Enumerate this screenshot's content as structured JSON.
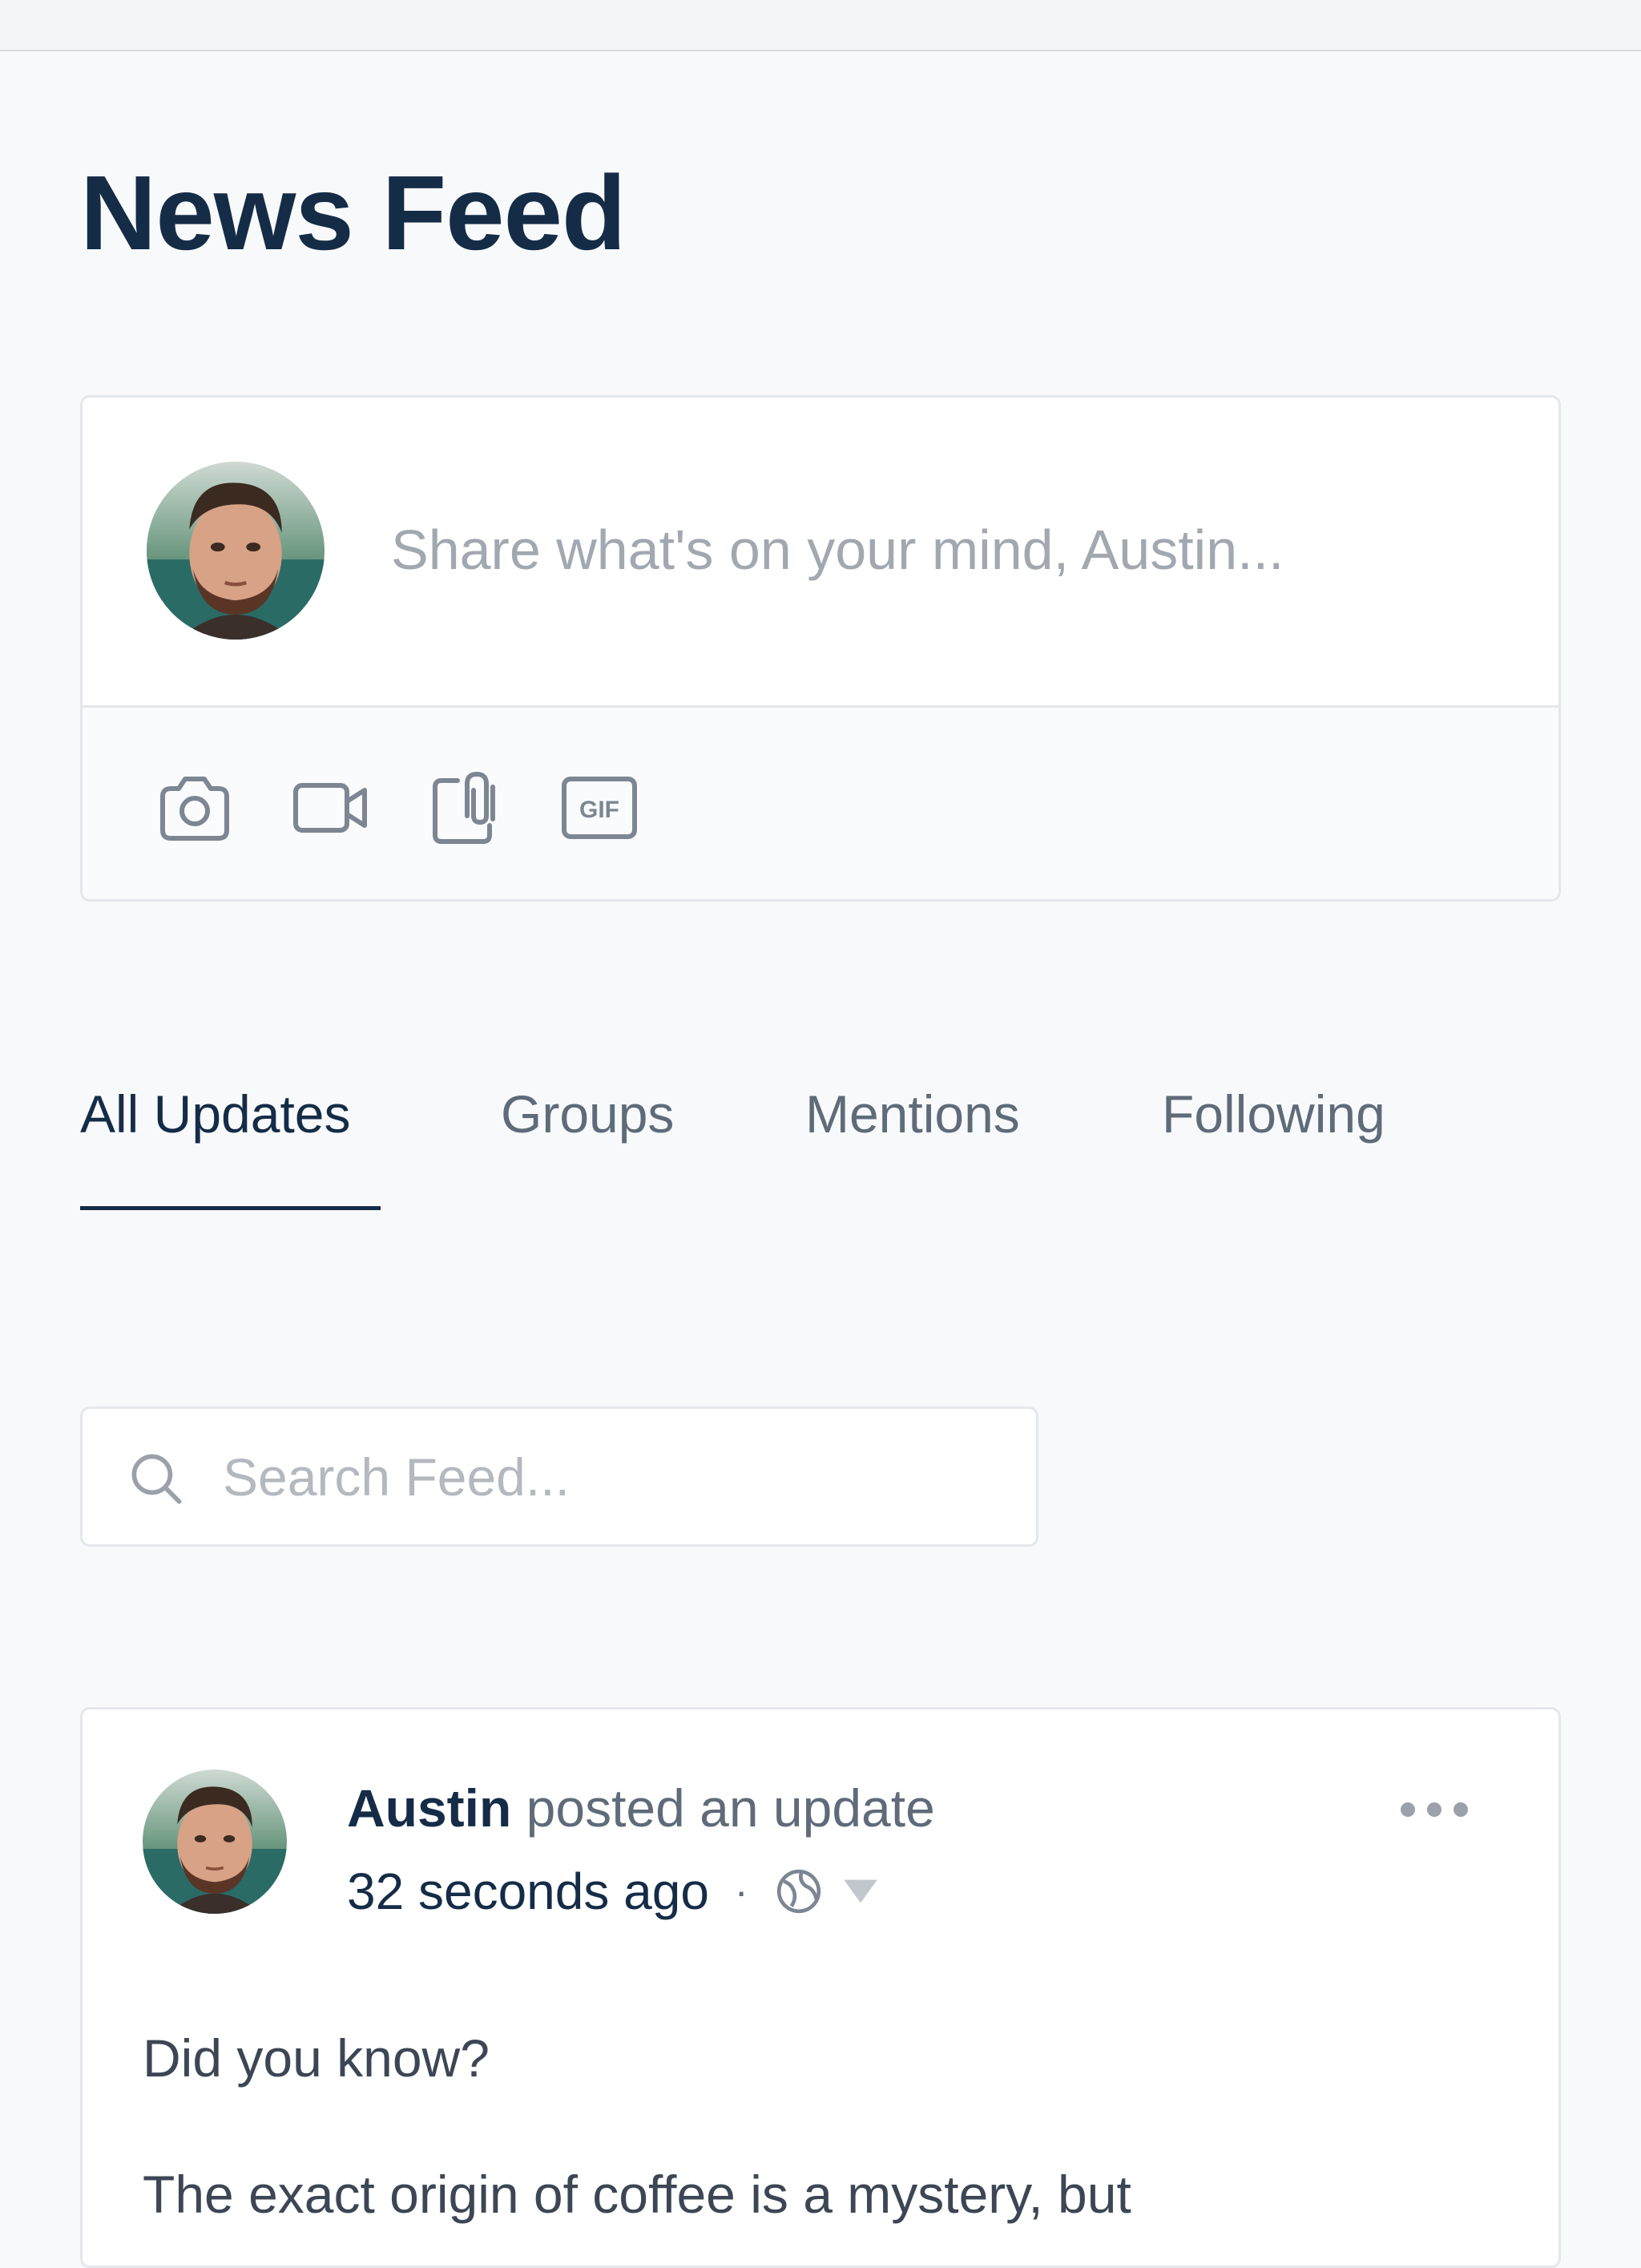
{
  "page": {
    "title": "News Feed"
  },
  "composer": {
    "placeholder": "Share what's on your mind, Austin...",
    "tools": [
      {
        "icon": "camera-icon"
      },
      {
        "icon": "video-icon"
      },
      {
        "icon": "attachment-icon"
      },
      {
        "icon": "gif-icon",
        "label": "GIF"
      }
    ]
  },
  "tabs": [
    {
      "label": "All Updates",
      "active": true
    },
    {
      "label": "Groups",
      "active": false
    },
    {
      "label": "Mentions",
      "active": false
    },
    {
      "label": "Following",
      "active": false
    }
  ],
  "search": {
    "placeholder": "Search Feed..."
  },
  "post": {
    "author": "Austin",
    "action": "posted an update",
    "time": "32 seconds ago",
    "separator": "·",
    "privacy_icon": "globe-icon",
    "more_icon": "more-horizontal-icon",
    "body": [
      "Did you know?",
      "The exact origin of coffee is a mystery, but"
    ]
  },
  "colors": {
    "title": "#152c47",
    "background": "#f8f9fb",
    "border": "#e4e7eb",
    "muted_text": "#5f6b79",
    "placeholder": "#a2a8b0",
    "icon": "#7d8692"
  }
}
